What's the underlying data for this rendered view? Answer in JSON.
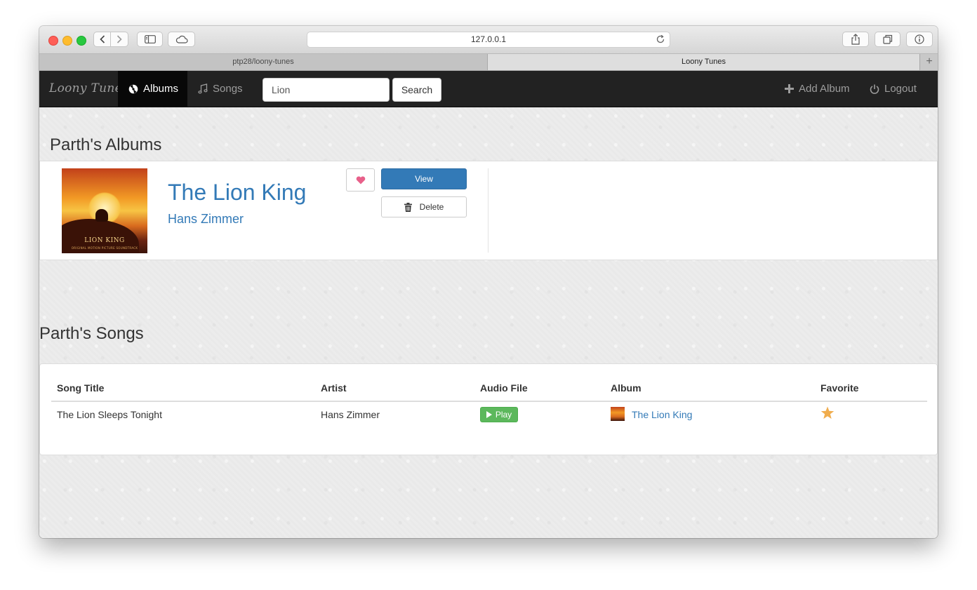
{
  "browser": {
    "url": "127.0.0.1",
    "tabs": [
      {
        "label": "ptp28/loony-tunes"
      },
      {
        "label": "Loony Tunes"
      }
    ],
    "new_tab_label": "+"
  },
  "navbar": {
    "brand": "Loony Tunes",
    "items": [
      {
        "label": "Albums",
        "icon": "disc-icon",
        "active": true
      },
      {
        "label": "Songs",
        "icon": "music-note-icon",
        "active": false
      }
    ],
    "search": {
      "value": "Lion",
      "placeholder": "",
      "button_label": "Search"
    },
    "right": [
      {
        "label": "Add Album",
        "icon": "plus-icon"
      },
      {
        "label": "Logout",
        "icon": "power-icon"
      }
    ]
  },
  "albums_section": {
    "heading": "Parth's Albums",
    "albums": [
      {
        "title": "The Lion King",
        "artist": "Hans Zimmer",
        "cover_title": "LION KING",
        "cover_subtitle": "ORIGINAL MOTION PICTURE SOUNDTRACK",
        "favorite": true,
        "view_label": "View",
        "delete_label": "Delete"
      }
    ]
  },
  "songs_section": {
    "heading": "Parth's Songs",
    "columns": [
      "Song Title",
      "Artist",
      "Audio File",
      "Album",
      "Favorite"
    ],
    "rows": [
      {
        "song_title": "The Lion Sleeps Tonight",
        "artist": "Hans Zimmer",
        "audio_label": "Play",
        "album": "The Lion King",
        "favorite": true
      }
    ]
  },
  "colors": {
    "navbar_bg": "#222222",
    "link": "#337ab7",
    "primary": "#337ab7",
    "success": "#5cb85c",
    "heart": "#e8608a",
    "star": "#f0ad4e"
  }
}
